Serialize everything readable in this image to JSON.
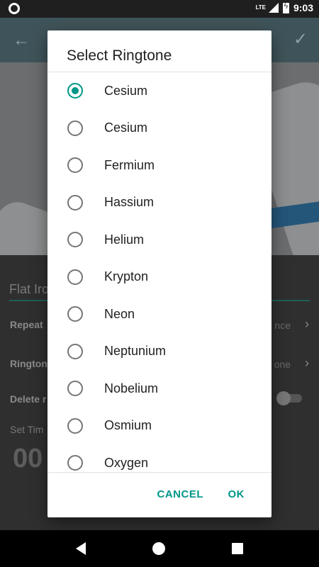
{
  "status_bar": {
    "network": "LTE",
    "time": "9:03"
  },
  "form": {
    "name_value": "Flat Iro",
    "repeat_label": "Repeat",
    "repeat_value": "nce",
    "ringtone_label": "Rington",
    "ringtone_value": "one",
    "delete_label": "Delete r",
    "timer_label": "Set Tim",
    "timer_value": "00"
  },
  "dialog": {
    "title": "Select Ringtone",
    "options": [
      {
        "label": "Cesium",
        "selected": true
      },
      {
        "label": "Cesium",
        "selected": false
      },
      {
        "label": "Fermium",
        "selected": false
      },
      {
        "label": "Hassium",
        "selected": false
      },
      {
        "label": "Helium",
        "selected": false
      },
      {
        "label": "Krypton",
        "selected": false
      },
      {
        "label": "Neon",
        "selected": false
      },
      {
        "label": "Neptunium",
        "selected": false
      },
      {
        "label": "Nobelium",
        "selected": false
      },
      {
        "label": "Osmium",
        "selected": false
      },
      {
        "label": "Oxygen",
        "selected": false
      }
    ],
    "cancel_label": "CANCEL",
    "ok_label": "OK"
  },
  "colors": {
    "accent": "#009688",
    "dialog_bg": "#ffffff",
    "scrim_app_bar": "#3f545a"
  }
}
